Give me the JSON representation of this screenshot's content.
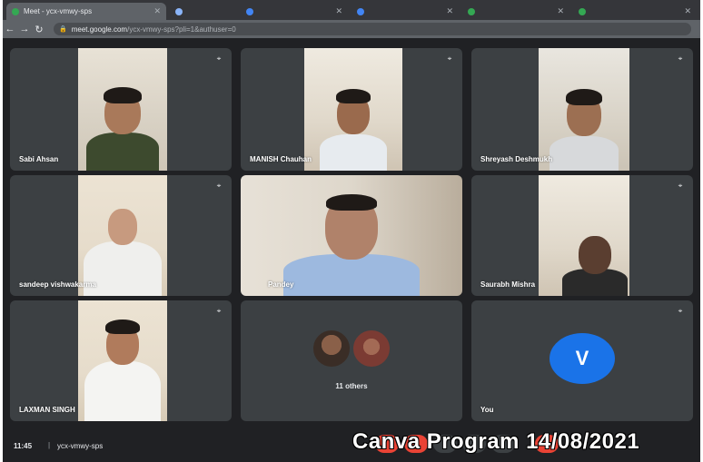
{
  "browser": {
    "tabs": [
      {
        "label": "Meet - ycx-vmwy-sps",
        "active": true
      },
      {
        "label": "",
        "active": false
      },
      {
        "label": "",
        "active": false
      },
      {
        "label": "",
        "active": false
      },
      {
        "label": "",
        "active": false
      },
      {
        "label": "",
        "active": false
      }
    ],
    "url_host": "meet.google.com",
    "url_path": "/ycx-vmwy-sps?pli=1&authuser=0",
    "nav_icons": [
      "back-arrow-icon",
      "forward-arrow-icon",
      "reload-icon"
    ]
  },
  "participants": [
    {
      "name": "Sabi Ahsan"
    },
    {
      "name": "MANISH Chauhan"
    },
    {
      "name": "Shreyash Deshmukh"
    },
    {
      "name": "sandeep vishwakarma"
    },
    {
      "name": "Pandey"
    },
    {
      "name": "Saurabh Mishra"
    },
    {
      "name": "LAXMAN SINGH"
    }
  ],
  "others_label": "11 others",
  "you": {
    "initial": "V",
    "label": "You",
    "avatar_color": "#1a73e8"
  },
  "bottom": {
    "time": "11:45",
    "separator": "|",
    "meeting_code": "ycx-vmwy-sps"
  },
  "watermark": "Canva Program 14/08/2021",
  "colors": {
    "background": "#202124",
    "tile": "#3c4043",
    "end_call": "#ea4335"
  }
}
